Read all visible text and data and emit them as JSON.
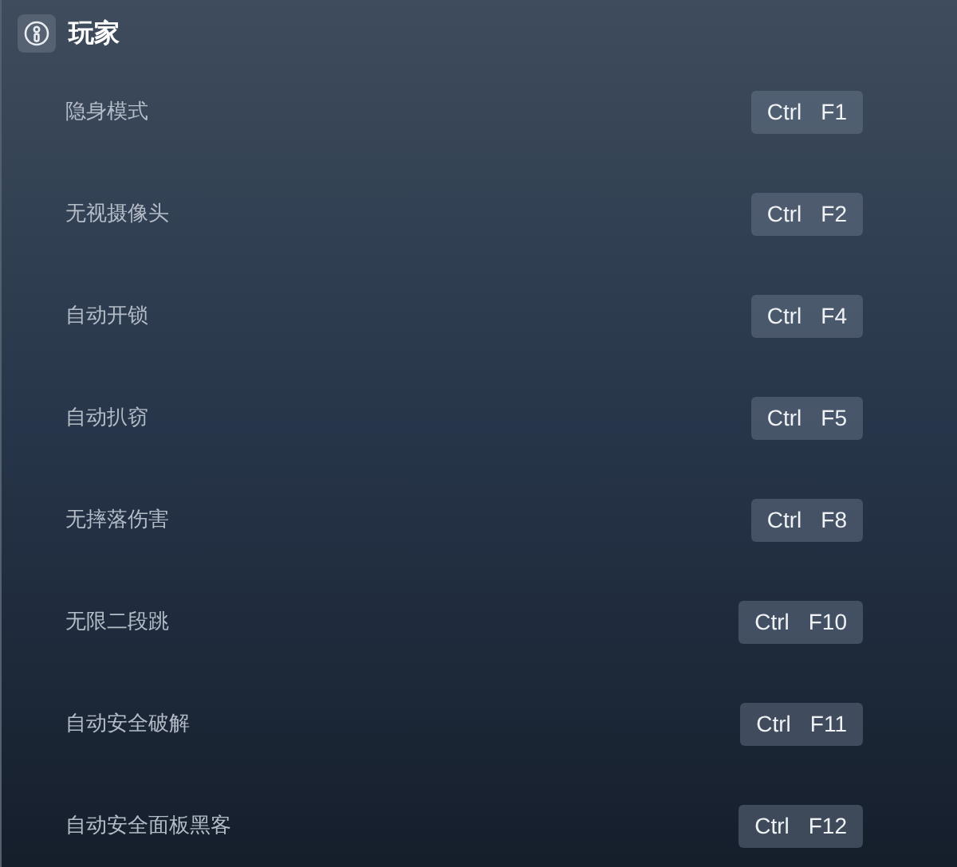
{
  "section": {
    "title": "玩家"
  },
  "hotkeys": [
    {
      "label": "隐身模式",
      "keys": [
        "Ctrl",
        "F1"
      ]
    },
    {
      "label": "无视摄像头",
      "keys": [
        "Ctrl",
        "F2"
      ]
    },
    {
      "label": "自动开锁",
      "keys": [
        "Ctrl",
        "F4"
      ]
    },
    {
      "label": "自动扒窃",
      "keys": [
        "Ctrl",
        "F5"
      ]
    },
    {
      "label": "无摔落伤害",
      "keys": [
        "Ctrl",
        "F8"
      ]
    },
    {
      "label": "无限二段跳",
      "keys": [
        "Ctrl",
        "F10"
      ]
    },
    {
      "label": "自动安全破解",
      "keys": [
        "Ctrl",
        "F11"
      ]
    },
    {
      "label": "自动安全面板黑客",
      "keys": [
        "Ctrl",
        "F12"
      ]
    }
  ]
}
